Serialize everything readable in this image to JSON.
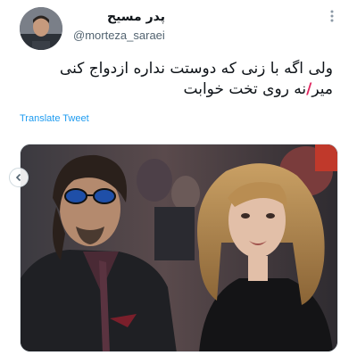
{
  "tweet": {
    "display_name": "پدر مسیح",
    "handle": "@morteza_saraei",
    "text_line_1": "ولی اگه با زنی که دوستت نداره ازدواج کنی",
    "text_line_2_before": "میر",
    "text_line_2_slash": "/",
    "text_line_2_after": "نه روی تخت خوابت",
    "translate_label": "Translate Tweet"
  },
  "icons": {
    "more": "more-options-icon",
    "carousel_prev": "chevron-left-icon"
  },
  "colors": {
    "link": "#1d9bf0",
    "slash": "#e0245e",
    "text": "#0f1419",
    "muted": "#536471"
  }
}
